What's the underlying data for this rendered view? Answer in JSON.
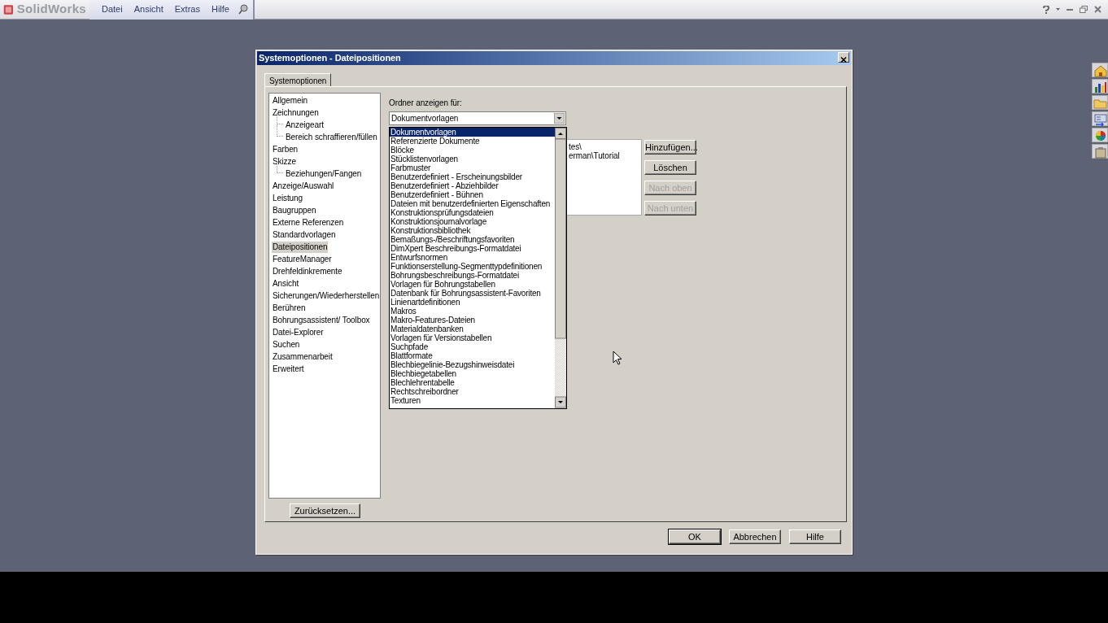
{
  "app": {
    "logo": "SolidWorks",
    "menu": [
      {
        "label": "Datei"
      },
      {
        "label": "Ansicht"
      },
      {
        "label": "Extras"
      },
      {
        "label": "Hilfe"
      }
    ]
  },
  "dialog": {
    "title": "Systemoptionen - Dateipositionen",
    "tabs": [
      {
        "label": "Systemoptionen",
        "selected": true
      }
    ],
    "tree": [
      {
        "label": "Allgemein",
        "selected": false
      },
      {
        "label": "Zeichnungen",
        "selected": false,
        "children": [
          {
            "label": "Anzeigeart",
            "selected": false
          },
          {
            "label": "Bereich schraffieren/füllen",
            "selected": false
          }
        ]
      },
      {
        "label": "Farben",
        "selected": false
      },
      {
        "label": "Skizze",
        "selected": false,
        "children": [
          {
            "label": "Beziehungen/Fangen",
            "selected": false
          }
        ]
      },
      {
        "label": "Anzeige/Auswahl",
        "selected": false
      },
      {
        "label": "Leistung",
        "selected": false
      },
      {
        "label": "Baugruppen",
        "selected": false
      },
      {
        "label": "Externe Referenzen",
        "selected": false
      },
      {
        "label": "Standardvorlagen",
        "selected": false
      },
      {
        "label": "Dateipositionen",
        "selected": true
      },
      {
        "label": "FeatureManager",
        "selected": false
      },
      {
        "label": "Drehfeldinkremente",
        "selected": false
      },
      {
        "label": "Ansicht",
        "selected": false
      },
      {
        "label": "Sicherungen/Wiederherstellen",
        "selected": false
      },
      {
        "label": "Berühren",
        "selected": false
      },
      {
        "label": "Bohrungsassistent/ Toolbox",
        "selected": false
      },
      {
        "label": "Datei-Explorer",
        "selected": false
      },
      {
        "label": "Suchen",
        "selected": false
      },
      {
        "label": "Zusammenarbeit",
        "selected": false
      },
      {
        "label": "Erweitert",
        "selected": false
      }
    ],
    "reset_button": "Zurücksetzen...",
    "folder_label": "Ordner anzeigen für:",
    "combo_value": "Dokumentvorlagen",
    "dropdown": [
      {
        "label": "Dokumentvorlagen",
        "selected": true
      },
      {
        "label": "Referenzierte Dokumente",
        "selected": false
      },
      {
        "label": "Blöcke",
        "selected": false
      },
      {
        "label": "Stücklistenvorlagen",
        "selected": false
      },
      {
        "label": "Farbmuster",
        "selected": false
      },
      {
        "label": "Benutzerdefiniert - Erscheinungsbilder",
        "selected": false
      },
      {
        "label": "Benutzerdefiniert - Abziehbilder",
        "selected": false
      },
      {
        "label": "Benutzerdefiniert -  Bühnen",
        "selected": false
      },
      {
        "label": "Dateien mit benutzerdefinierten Eigenschaften",
        "selected": false
      },
      {
        "label": "Konstruktionsprüfungsdateien",
        "selected": false
      },
      {
        "label": "Konstruktionsjournalvorlage",
        "selected": false
      },
      {
        "label": "Konstruktionsbibliothek",
        "selected": false
      },
      {
        "label": "Bemaßungs-/Beschriftungsfavoriten",
        "selected": false
      },
      {
        "label": "DimXpert Beschreibungs-Formatdatei",
        "selected": false
      },
      {
        "label": "Entwurfsnormen",
        "selected": false
      },
      {
        "label": "Funktionserstellung-Segmenttypdefinitionen",
        "selected": false
      },
      {
        "label": "Bohrungsbeschreibungs-Formatdatei",
        "selected": false
      },
      {
        "label": "Vorlagen für Bohrungstabellen",
        "selected": false
      },
      {
        "label": "Datenbank für Bohrungsassistent-Favoriten",
        "selected": false
      },
      {
        "label": "Linienartdefinitionen",
        "selected": false
      },
      {
        "label": "Makros",
        "selected": false
      },
      {
        "label": "Makro-Features-Dateien",
        "selected": false
      },
      {
        "label": "Materialdatenbanken",
        "selected": false
      },
      {
        "label": "Vorlagen für Versionstabellen",
        "selected": false
      },
      {
        "label": "Suchpfade",
        "selected": false
      },
      {
        "label": "Blattformate",
        "selected": false
      },
      {
        "label": "Blechbiegelinie-Bezugshinweisdatei",
        "selected": false
      },
      {
        "label": "Blechbiegetabellen",
        "selected": false
      },
      {
        "label": "Blechlehrentabelle",
        "selected": false
      },
      {
        "label": "Rechtschreibordner",
        "selected": false
      },
      {
        "label": "Texturen",
        "selected": false
      }
    ],
    "paths": [
      "tes\\",
      "erman\\Tutorial"
    ],
    "side_buttons": [
      {
        "label": "Hinzufügen...",
        "disabled": false
      },
      {
        "label": "Löschen",
        "disabled": false
      },
      {
        "label": "Nach oben",
        "disabled": true
      },
      {
        "label": "Nach unten",
        "disabled": true
      }
    ],
    "footer_buttons": [
      {
        "label": "OK",
        "default": true
      },
      {
        "label": "Abbrechen",
        "default": false
      },
      {
        "label": "Hilfe",
        "default": false
      }
    ]
  }
}
